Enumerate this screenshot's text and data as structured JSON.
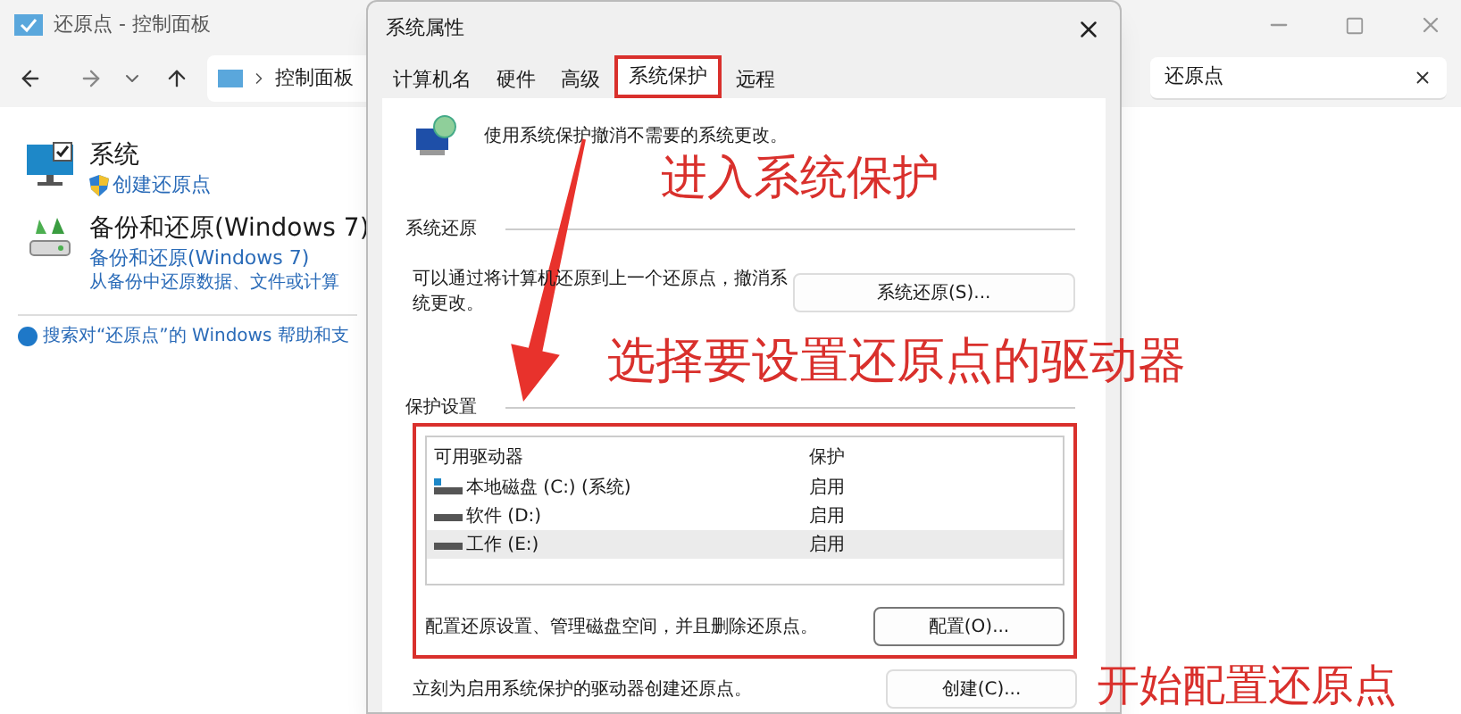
{
  "window": {
    "title": "还原点 - 控制面板",
    "address": "控制面板",
    "search": {
      "value": "还原点"
    }
  },
  "items": [
    {
      "kind": "system",
      "title": "系统",
      "links": [
        "创建还原点"
      ]
    },
    {
      "kind": "backup",
      "title": "备份和还原(Windows 7)",
      "links": [
        "备份和还原(Windows 7)"
      ],
      "note": "从备份中还原数据、文件或计算"
    }
  ],
  "help_link": "搜索对“还原点”的 Windows 帮助和支",
  "dialog": {
    "title": "系统属性",
    "tabs": [
      {
        "label": "计算机名",
        "selected": false
      },
      {
        "label": "硬件",
        "selected": false
      },
      {
        "label": "高级",
        "selected": false
      },
      {
        "label": "系统保护",
        "selected": true
      },
      {
        "label": "远程",
        "selected": false
      }
    ],
    "description": "使用系统保护撤消不需要的系统更改。",
    "restore": {
      "heading": "系统还原",
      "text": "可以通过将计算机还原到上一个还原点，撤消系统更改。",
      "button": "系统还原(S)..."
    },
    "protection": {
      "heading": "保护设置",
      "columns": [
        "可用驱动器",
        "保护"
      ],
      "drives": [
        {
          "kind": "system",
          "name": "本地磁盘 (C:) (系统)",
          "protection": "启用",
          "selected": false
        },
        {
          "kind": "drive",
          "name": "软件 (D:)",
          "protection": "启用",
          "selected": false
        },
        {
          "kind": "drive",
          "name": "工作 (E:)",
          "protection": "启用",
          "selected": true
        }
      ],
      "configure_text": "配置还原设置、管理磁盘空间，并且删除还原点。",
      "configure_button": "配置(O)..."
    },
    "create": {
      "text": "立刻为启用系统保护的驱动器创建还原点。",
      "button": "创建(C)..."
    }
  },
  "annotations": [
    "进入系统保护",
    "选择要设置还原点的驱动器",
    "开始配置还原点"
  ]
}
